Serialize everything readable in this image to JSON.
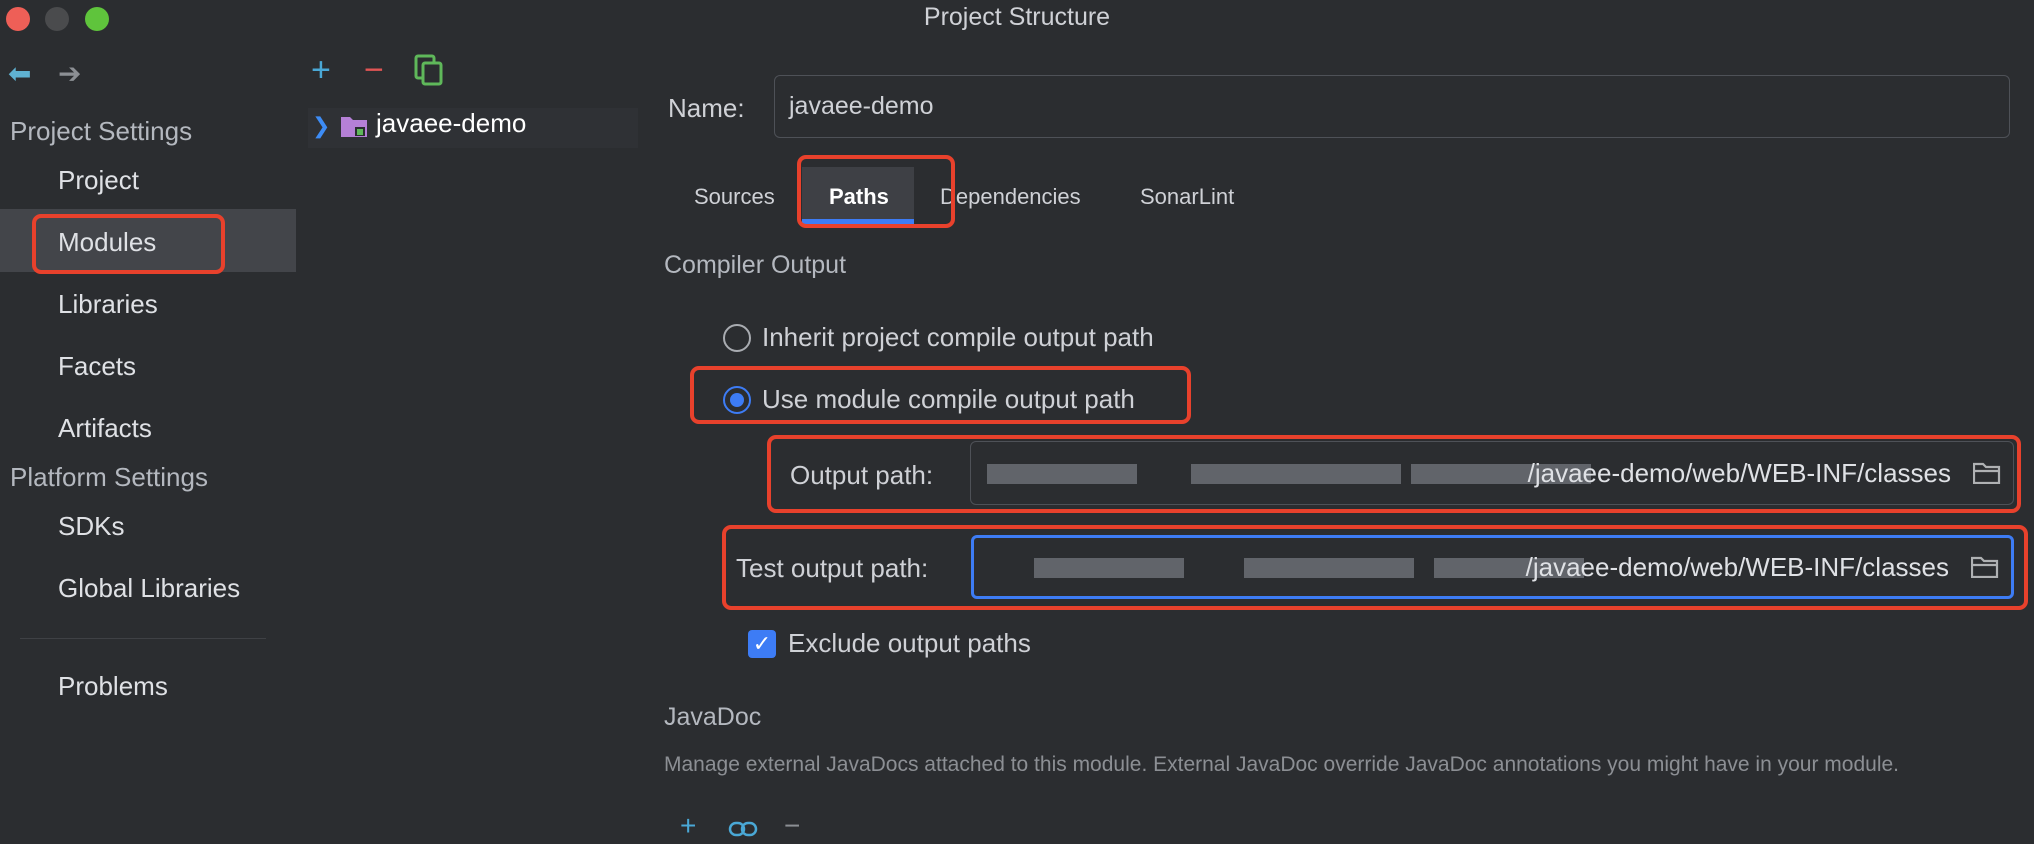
{
  "window": {
    "title": "Project Structure"
  },
  "nav": {
    "back_icon": "arrow-left-icon",
    "forward_icon": "arrow-right-icon"
  },
  "sidebar": {
    "project_settings_header": "Project Settings",
    "project_items": [
      "Project",
      "Modules",
      "Libraries",
      "Facets",
      "Artifacts"
    ],
    "selected": "Modules",
    "platform_settings_header": "Platform Settings",
    "platform_items": [
      "SDKs",
      "Global Libraries"
    ],
    "problems": "Problems"
  },
  "module_tree": {
    "toolbar": {
      "add": "+",
      "remove": "−"
    },
    "modules": [
      {
        "label": "javaee-demo"
      }
    ]
  },
  "module": {
    "name_label": "Name:",
    "name_value": "javaee-demo",
    "tabs": [
      "Sources",
      "Paths",
      "Dependencies",
      "SonarLint"
    ],
    "active_tab": "Paths"
  },
  "compiler_output": {
    "title": "Compiler Output",
    "inherit_option": "Inherit project compile output path",
    "module_option": "Use module compile output path",
    "selected_option": "module",
    "output_path_label": "Output path:",
    "output_path_value": "/javaee-demo/web/WEB-INF/classes",
    "test_output_path_label": "Test output path:",
    "test_output_path_value": "/javaee-demo/web/WEB-INF/classes",
    "exclude_label": "Exclude output paths",
    "exclude_checked": true
  },
  "javadoc": {
    "title": "JavaDoc",
    "description": "Manage external JavaDocs attached to this module. External JavaDoc override JavaDoc annotations you might have in your module.",
    "toolbar": {
      "add": "+",
      "remove": "−"
    }
  },
  "colors": {
    "accent": "#3d7cf5",
    "highlight_box": "#e8412c",
    "background": "#2b2d30",
    "selection": "#43454a"
  }
}
